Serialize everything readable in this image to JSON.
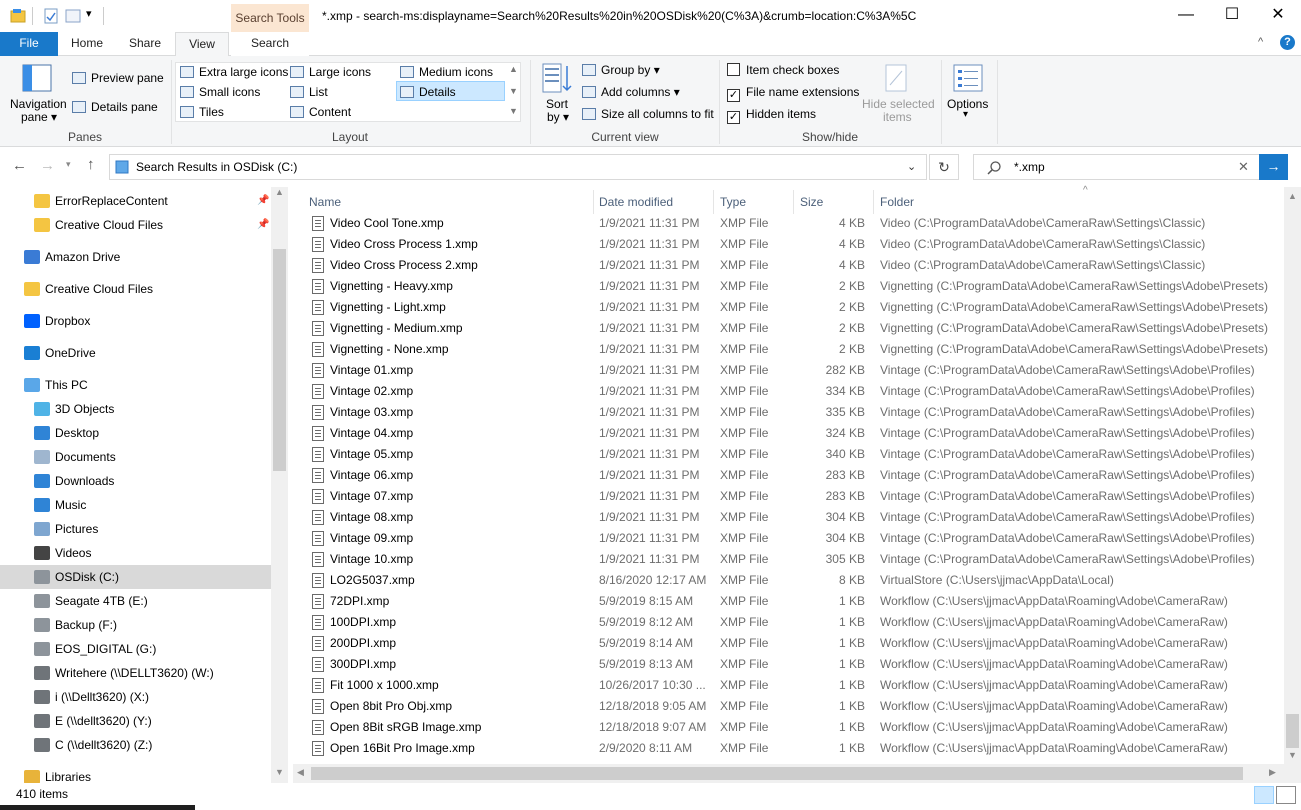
{
  "title_bar": {
    "title": "*.xmp - search-ms:displayname=Search%20Results%20in%20OSDisk%20(C%3A)&crumb=location:C%3A%5C",
    "context_tab": "Search Tools",
    "minimize": "—",
    "maximize": "☐",
    "close": "✕"
  },
  "tabs": [
    {
      "label": "File"
    },
    {
      "label": "Home"
    },
    {
      "label": "Share"
    },
    {
      "label": "View"
    },
    {
      "label": "Search"
    }
  ],
  "ribbon": {
    "panes": {
      "navigation_pane": "Navigation",
      "navigation_pane_2": "pane ▾",
      "preview_pane": "Preview pane",
      "details_pane": "Details pane",
      "group_label": "Panes"
    },
    "layout": {
      "items": [
        "Extra large icons",
        "Large icons",
        "Medium icons",
        "Small icons",
        "List",
        "Details",
        "Tiles",
        "Content"
      ],
      "selected": "Details",
      "group_label": "Layout"
    },
    "current_view": {
      "sort_by": "Sort",
      "sort_by_2": "by ▾",
      "group_by": "Group by ▾",
      "add_columns": "Add columns ▾",
      "size_all_columns": "Size all columns to fit",
      "group_label": "Current view"
    },
    "show_hide": {
      "item_check_boxes": "Item check boxes",
      "file_name_extensions": "File name extensions",
      "hidden_items": "Hidden items",
      "hide_selected": "Hide selected",
      "hide_selected_2": "items",
      "group_label": "Show/hide"
    },
    "options": {
      "label": "Options",
      "label_2": "▾"
    }
  },
  "address_bar": {
    "path": "Search Results in OSDisk (C:)",
    "search_value": "*.xmp"
  },
  "nav_pane": {
    "items": [
      {
        "label": "ErrorReplaceContent",
        "icon": "folder-icon"
      },
      {
        "label": "Creative Cloud Files",
        "icon": "cc-folder-icon"
      },
      {
        "label": "Amazon Drive",
        "icon": "amazon-drive-icon"
      },
      {
        "label": "Creative Cloud Files",
        "icon": "cc-folder-icon"
      },
      {
        "label": "Dropbox",
        "icon": "dropbox-icon"
      },
      {
        "label": "OneDrive",
        "icon": "onedrive-icon"
      },
      {
        "label": "This PC",
        "icon": "pc-icon"
      },
      {
        "label": "3D Objects",
        "icon": "3d-objects-icon"
      },
      {
        "label": "Desktop",
        "icon": "desktop-icon"
      },
      {
        "label": "Documents",
        "icon": "documents-icon"
      },
      {
        "label": "Downloads",
        "icon": "downloads-icon"
      },
      {
        "label": "Music",
        "icon": "music-icon"
      },
      {
        "label": "Pictures",
        "icon": "pictures-icon"
      },
      {
        "label": "Videos",
        "icon": "videos-icon"
      },
      {
        "label": "OSDisk (C:)",
        "icon": "drive-icon"
      },
      {
        "label": "Seagate 4TB (E:)",
        "icon": "drive-icon"
      },
      {
        "label": "Backup (F:)",
        "icon": "drive-icon"
      },
      {
        "label": "EOS_DIGITAL (G:)",
        "icon": "drive-icon"
      },
      {
        "label": "Writehere (\\\\DELLT3620) (W:)",
        "icon": "network-drive-icon"
      },
      {
        "label": "i (\\\\Dellt3620) (X:)",
        "icon": "network-drive-icon"
      },
      {
        "label": "E (\\\\dellt3620) (Y:)",
        "icon": "network-drive-icon"
      },
      {
        "label": "C (\\\\dellt3620) (Z:)",
        "icon": "network-drive-icon"
      },
      {
        "label": "Libraries",
        "icon": "libraries-icon"
      }
    ],
    "selected": "OSDisk (C:)"
  },
  "columns": {
    "name": "Name",
    "date": "Date modified",
    "type": "Type",
    "size": "Size",
    "folder": "Folder"
  },
  "files": [
    {
      "name": "Video Cool Tone.xmp",
      "date": "1/9/2021 11:31 PM",
      "type": "XMP File",
      "size": "4 KB",
      "folder": "Video (C:\\ProgramData\\Adobe\\CameraRaw\\Settings\\Classic)"
    },
    {
      "name": "Video Cross Process 1.xmp",
      "date": "1/9/2021 11:31 PM",
      "type": "XMP File",
      "size": "4 KB",
      "folder": "Video (C:\\ProgramData\\Adobe\\CameraRaw\\Settings\\Classic)"
    },
    {
      "name": "Video Cross Process 2.xmp",
      "date": "1/9/2021 11:31 PM",
      "type": "XMP File",
      "size": "4 KB",
      "folder": "Video (C:\\ProgramData\\Adobe\\CameraRaw\\Settings\\Classic)"
    },
    {
      "name": "Vignetting - Heavy.xmp",
      "date": "1/9/2021 11:31 PM",
      "type": "XMP File",
      "size": "2 KB",
      "folder": "Vignetting (C:\\ProgramData\\Adobe\\CameraRaw\\Settings\\Adobe\\Presets)"
    },
    {
      "name": "Vignetting - Light.xmp",
      "date": "1/9/2021 11:31 PM",
      "type": "XMP File",
      "size": "2 KB",
      "folder": "Vignetting (C:\\ProgramData\\Adobe\\CameraRaw\\Settings\\Adobe\\Presets)"
    },
    {
      "name": "Vignetting - Medium.xmp",
      "date": "1/9/2021 11:31 PM",
      "type": "XMP File",
      "size": "2 KB",
      "folder": "Vignetting (C:\\ProgramData\\Adobe\\CameraRaw\\Settings\\Adobe\\Presets)"
    },
    {
      "name": "Vignetting - None.xmp",
      "date": "1/9/2021 11:31 PM",
      "type": "XMP File",
      "size": "2 KB",
      "folder": "Vignetting (C:\\ProgramData\\Adobe\\CameraRaw\\Settings\\Adobe\\Presets)"
    },
    {
      "name": "Vintage 01.xmp",
      "date": "1/9/2021 11:31 PM",
      "type": "XMP File",
      "size": "282 KB",
      "folder": "Vintage (C:\\ProgramData\\Adobe\\CameraRaw\\Settings\\Adobe\\Profiles)"
    },
    {
      "name": "Vintage 02.xmp",
      "date": "1/9/2021 11:31 PM",
      "type": "XMP File",
      "size": "334 KB",
      "folder": "Vintage (C:\\ProgramData\\Adobe\\CameraRaw\\Settings\\Adobe\\Profiles)"
    },
    {
      "name": "Vintage 03.xmp",
      "date": "1/9/2021 11:31 PM",
      "type": "XMP File",
      "size": "335 KB",
      "folder": "Vintage (C:\\ProgramData\\Adobe\\CameraRaw\\Settings\\Adobe\\Profiles)"
    },
    {
      "name": "Vintage 04.xmp",
      "date": "1/9/2021 11:31 PM",
      "type": "XMP File",
      "size": "324 KB",
      "folder": "Vintage (C:\\ProgramData\\Adobe\\CameraRaw\\Settings\\Adobe\\Profiles)"
    },
    {
      "name": "Vintage 05.xmp",
      "date": "1/9/2021 11:31 PM",
      "type": "XMP File",
      "size": "340 KB",
      "folder": "Vintage (C:\\ProgramData\\Adobe\\CameraRaw\\Settings\\Adobe\\Profiles)"
    },
    {
      "name": "Vintage 06.xmp",
      "date": "1/9/2021 11:31 PM",
      "type": "XMP File",
      "size": "283 KB",
      "folder": "Vintage (C:\\ProgramData\\Adobe\\CameraRaw\\Settings\\Adobe\\Profiles)"
    },
    {
      "name": "Vintage 07.xmp",
      "date": "1/9/2021 11:31 PM",
      "type": "XMP File",
      "size": "283 KB",
      "folder": "Vintage (C:\\ProgramData\\Adobe\\CameraRaw\\Settings\\Adobe\\Profiles)"
    },
    {
      "name": "Vintage 08.xmp",
      "date": "1/9/2021 11:31 PM",
      "type": "XMP File",
      "size": "304 KB",
      "folder": "Vintage (C:\\ProgramData\\Adobe\\CameraRaw\\Settings\\Adobe\\Profiles)"
    },
    {
      "name": "Vintage 09.xmp",
      "date": "1/9/2021 11:31 PM",
      "type": "XMP File",
      "size": "304 KB",
      "folder": "Vintage (C:\\ProgramData\\Adobe\\CameraRaw\\Settings\\Adobe\\Profiles)"
    },
    {
      "name": "Vintage 10.xmp",
      "date": "1/9/2021 11:31 PM",
      "type": "XMP File",
      "size": "305 KB",
      "folder": "Vintage (C:\\ProgramData\\Adobe\\CameraRaw\\Settings\\Adobe\\Profiles)"
    },
    {
      "name": "LO2G5037.xmp",
      "date": "8/16/2020 12:17 AM",
      "type": "XMP File",
      "size": "8 KB",
      "folder": "VirtualStore (C:\\Users\\jjmac\\AppData\\Local)"
    },
    {
      "name": "72DPI.xmp",
      "date": "5/9/2019 8:15 AM",
      "type": "XMP File",
      "size": "1 KB",
      "folder": "Workflow (C:\\Users\\jjmac\\AppData\\Roaming\\Adobe\\CameraRaw)"
    },
    {
      "name": "100DPI.xmp",
      "date": "5/9/2019 8:12 AM",
      "type": "XMP File",
      "size": "1 KB",
      "folder": "Workflow (C:\\Users\\jjmac\\AppData\\Roaming\\Adobe\\CameraRaw)"
    },
    {
      "name": "200DPI.xmp",
      "date": "5/9/2019 8:14 AM",
      "type": "XMP File",
      "size": "1 KB",
      "folder": "Workflow (C:\\Users\\jjmac\\AppData\\Roaming\\Adobe\\CameraRaw)"
    },
    {
      "name": "300DPI.xmp",
      "date": "5/9/2019 8:13 AM",
      "type": "XMP File",
      "size": "1 KB",
      "folder": "Workflow (C:\\Users\\jjmac\\AppData\\Roaming\\Adobe\\CameraRaw)"
    },
    {
      "name": "Fit 1000 x 1000.xmp",
      "date": "10/26/2017 10:30 ...",
      "type": "XMP File",
      "size": "1 KB",
      "folder": "Workflow (C:\\Users\\jjmac\\AppData\\Roaming\\Adobe\\CameraRaw)"
    },
    {
      "name": "Open 8bit Pro Obj.xmp",
      "date": "12/18/2018 9:05 AM",
      "type": "XMP File",
      "size": "1 KB",
      "folder": "Workflow (C:\\Users\\jjmac\\AppData\\Roaming\\Adobe\\CameraRaw)"
    },
    {
      "name": "Open 8Bit sRGB Image.xmp",
      "date": "12/18/2018 9:07 AM",
      "type": "XMP File",
      "size": "1 KB",
      "folder": "Workflow (C:\\Users\\jjmac\\AppData\\Roaming\\Adobe\\CameraRaw)"
    },
    {
      "name": "Open 16Bit Pro Image.xmp",
      "date": "2/9/2020 8:11 AM",
      "type": "XMP File",
      "size": "1 KB",
      "folder": "Workflow (C:\\Users\\jjmac\\AppData\\Roaming\\Adobe\\CameraRaw)"
    }
  ],
  "status": {
    "count": "410 items"
  },
  "colors": {
    "file_tab": "#1979ca",
    "search_tools": "#fbe6d2",
    "selected_nav": "#d9d9d9"
  }
}
